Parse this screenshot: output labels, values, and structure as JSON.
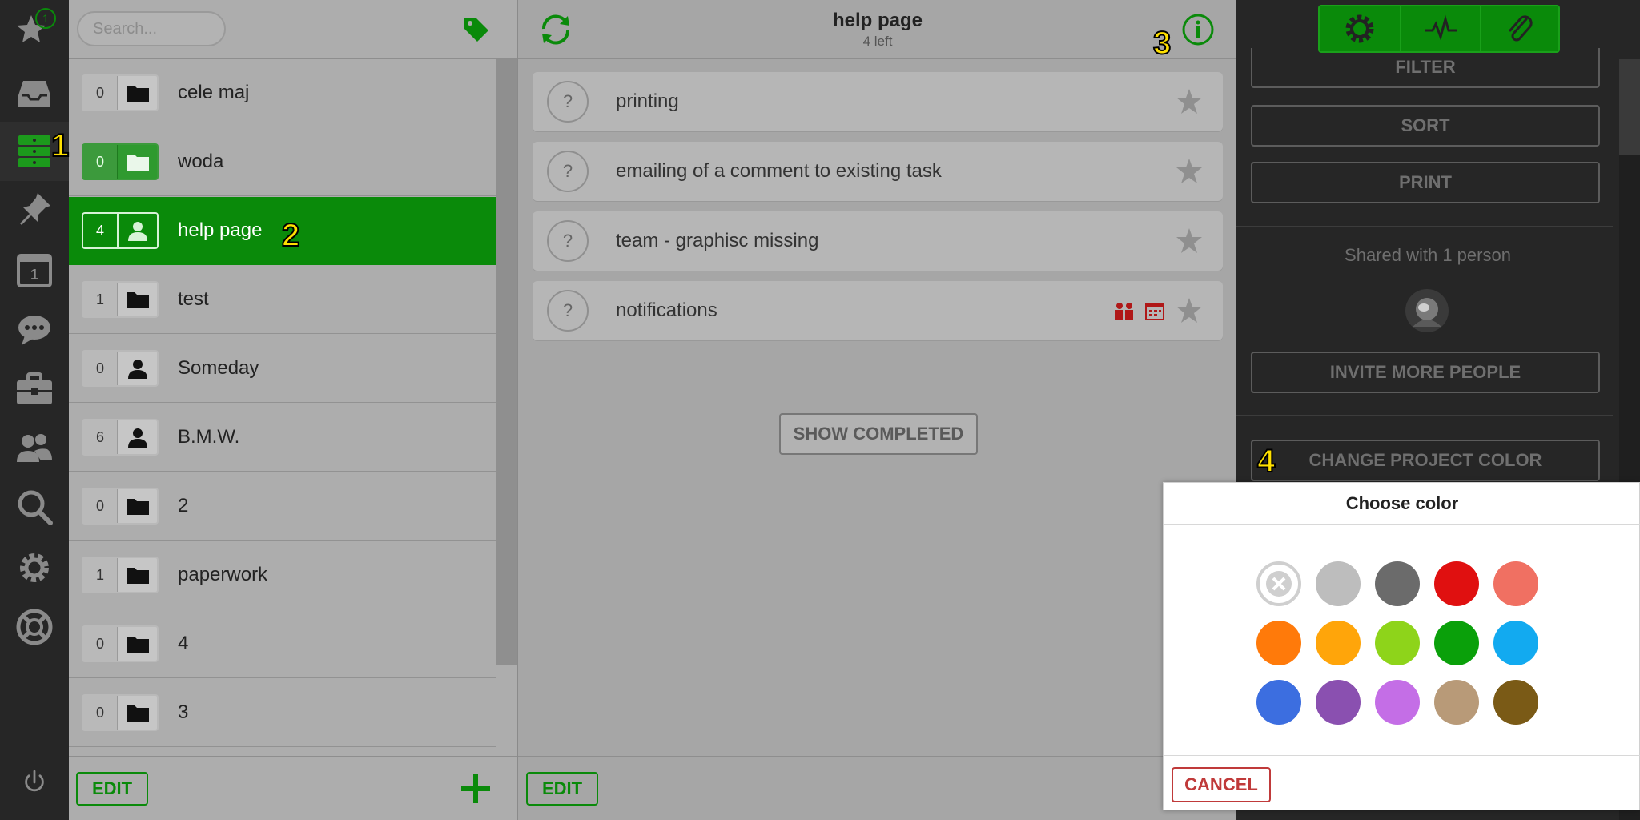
{
  "rail": {
    "notification_count": "1"
  },
  "search": {
    "placeholder": "Search..."
  },
  "projects": [
    {
      "count": "0",
      "name": "cele maj"
    },
    {
      "count": "0",
      "name": "woda"
    },
    {
      "count": "4",
      "name": "help page"
    },
    {
      "count": "1",
      "name": "test"
    },
    {
      "count": "0",
      "name": "Someday"
    },
    {
      "count": "6",
      "name": "B.M.W."
    },
    {
      "count": "0",
      "name": "2"
    },
    {
      "count": "1",
      "name": "paperwork"
    },
    {
      "count": "0",
      "name": "4"
    },
    {
      "count": "0",
      "name": "3"
    }
  ],
  "project_list": {
    "edit_label": "EDIT"
  },
  "task_panel": {
    "title": "help page",
    "subtitle": "4 left",
    "tasks": [
      {
        "name": "printing"
      },
      {
        "name": "emailing of a comment to existing task"
      },
      {
        "name": "team - graphisc missing"
      },
      {
        "name": "notifications"
      }
    ],
    "show_completed_label": "SHOW COMPLETED",
    "edit_label": "EDIT"
  },
  "right_panel": {
    "filter_label": "FILTER",
    "sort_label": "SORT",
    "print_label": "PRINT",
    "shared_text": "Shared with 1 person",
    "invite_label": "INVITE MORE PEOPLE",
    "change_color_label": "CHANGE PROJECT COLOR"
  },
  "color_dialog": {
    "title": "Choose color",
    "cancel_label": "CANCEL",
    "colors": [
      "#bdbdbd",
      "#6b6b6b",
      "#e01010",
      "#f07062",
      "#ff7a0a",
      "#ffa50a",
      "#8ed41a",
      "#0aa00a",
      "#12aaf0",
      "#3c6ee0",
      "#8a50b0",
      "#c46ee6",
      "#b89a78",
      "#7a5a16"
    ]
  },
  "markers": [
    "1",
    "2",
    "3",
    "4"
  ],
  "accent": "#0a8a0a"
}
